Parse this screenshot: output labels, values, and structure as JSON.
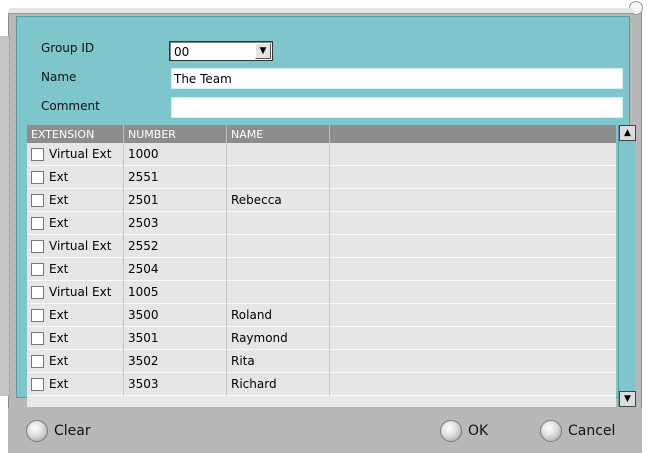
{
  "form": {
    "group_id_label": "Group ID",
    "group_id_value": "00",
    "name_label": "Name",
    "name_value": "The Team",
    "comment_label": "Comment",
    "comment_value": ""
  },
  "table": {
    "columns": [
      "EXTENSION",
      "NUMBER",
      "NAME",
      ""
    ],
    "rows": [
      {
        "type": "Virtual Ext",
        "number": "1000",
        "name": ""
      },
      {
        "type": "Ext",
        "number": "2551",
        "name": ""
      },
      {
        "type": "Ext",
        "number": "2501",
        "name": "Rebecca"
      },
      {
        "type": "Ext",
        "number": "2503",
        "name": ""
      },
      {
        "type": "Virtual Ext",
        "number": "2552",
        "name": ""
      },
      {
        "type": "Ext",
        "number": "2504",
        "name": ""
      },
      {
        "type": "Virtual Ext",
        "number": "1005",
        "name": ""
      },
      {
        "type": "Ext",
        "number": "3500",
        "name": "Roland"
      },
      {
        "type": "Ext",
        "number": "3501",
        "name": "Raymond"
      },
      {
        "type": "Ext",
        "number": "3502",
        "name": "Rita"
      },
      {
        "type": "Ext",
        "number": "3503",
        "name": "Richard"
      }
    ]
  },
  "buttons": {
    "clear": "Clear",
    "ok": "OK",
    "cancel": "Cancel"
  },
  "colors": {
    "panel": "#7ec5cc",
    "header": "#8d8d8d",
    "frame": "#b8b8b8"
  }
}
